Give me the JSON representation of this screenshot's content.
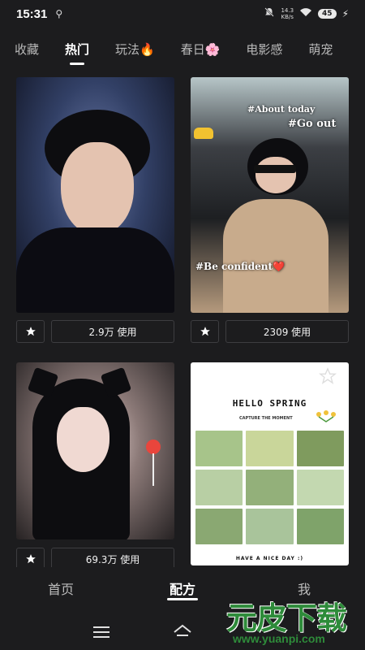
{
  "status_bar": {
    "time": "15:31",
    "usb_icon": "usb-icon",
    "net_speed_value": "14.3",
    "net_speed_unit": "KB/s",
    "battery": "45"
  },
  "tabs": [
    {
      "label": "收藏",
      "active": false
    },
    {
      "label": "热门",
      "active": true
    },
    {
      "label": "玩法🔥",
      "active": false
    },
    {
      "label": "春日🌸",
      "active": false
    },
    {
      "label": "电影感",
      "active": false
    },
    {
      "label": "萌宠",
      "active": false
    }
  ],
  "cards": [
    {
      "usage": "2.9万 使用"
    },
    {
      "usage": "2309 使用",
      "overlay": {
        "top": "#About today",
        "middle": "#Go out",
        "bottom": "#Be confident❤️"
      }
    },
    {
      "usage": "69.3万 使用"
    },
    {
      "spring": {
        "title": "HELLO SPRING",
        "subtitle": "CAPTURE THE MOMENT",
        "footer": "HAVE A NICE DAY :)"
      }
    }
  ],
  "bottom_nav": [
    {
      "label": "首页",
      "active": false
    },
    {
      "label": "配方",
      "active": true
    },
    {
      "label": "我",
      "active": false
    }
  ],
  "watermark": {
    "main": "元皮下载",
    "url": "www.yuanpi.com"
  },
  "colors": {
    "background": "#1c1c1e",
    "border": "#3d3d40",
    "watermark_green": "#2e8b3a"
  }
}
